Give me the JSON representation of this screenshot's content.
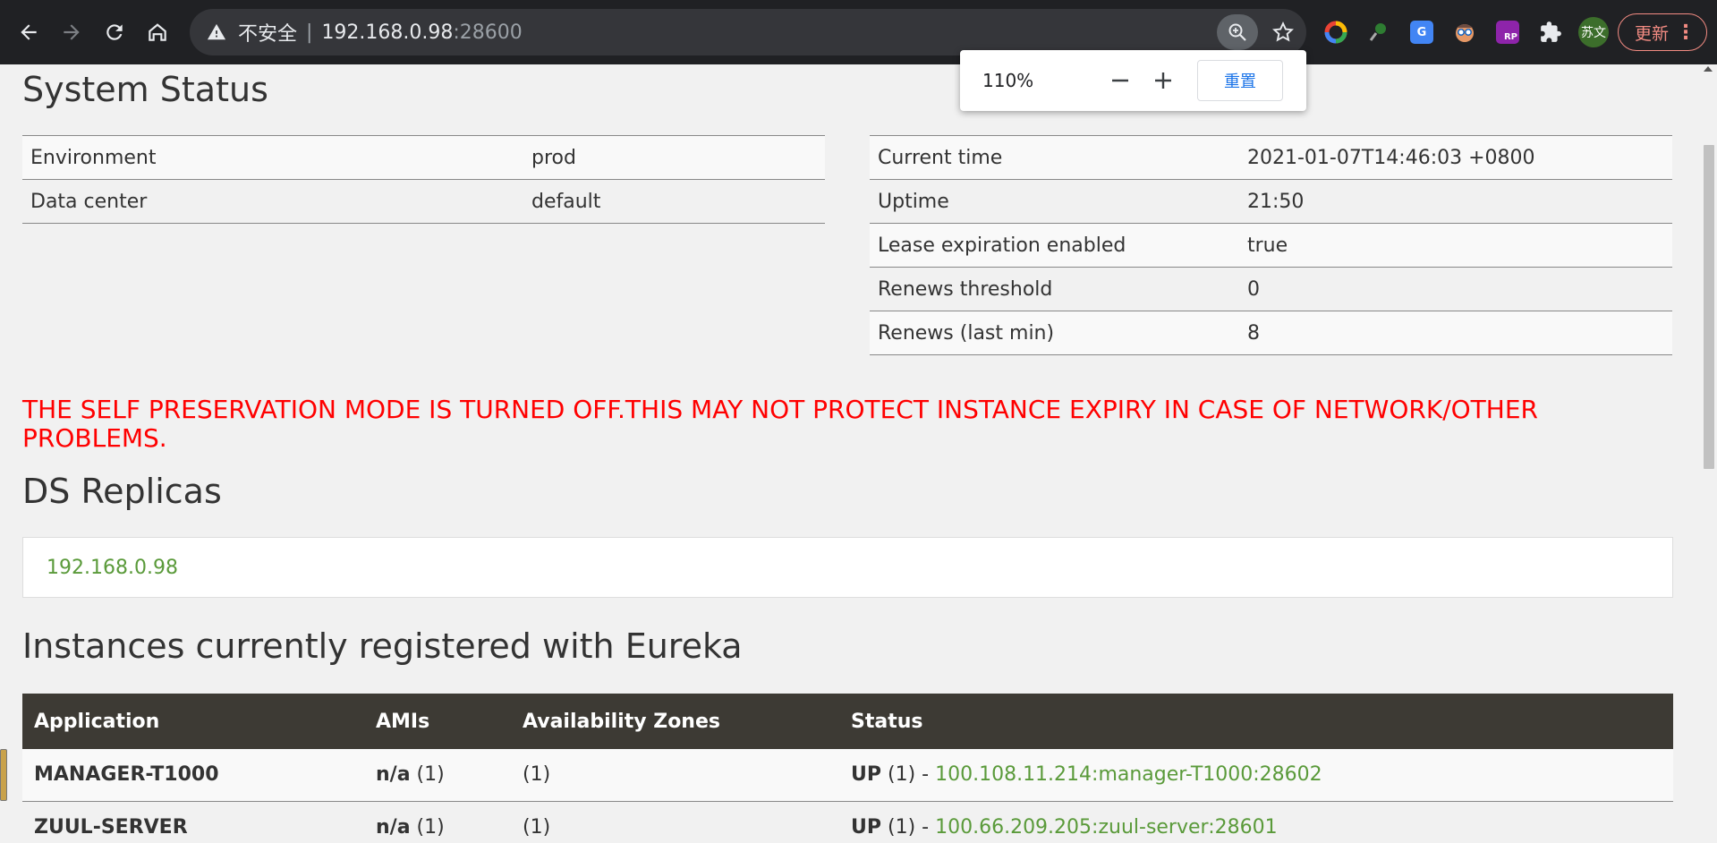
{
  "browser": {
    "security_label": "不安全",
    "separator": "|",
    "url_host": "192.168.0.98",
    "url_port": ":28600",
    "update_label": "更新",
    "profile_initials": "苏文"
  },
  "zoom_popup": {
    "level": "110%",
    "minus": "−",
    "plus": "+",
    "reset_label": "重置"
  },
  "system_status": {
    "title": "System Status",
    "left_rows": [
      {
        "label": "Environment",
        "value": "prod"
      },
      {
        "label": "Data center",
        "value": "default"
      }
    ],
    "right_rows": [
      {
        "label": "Current time",
        "value": "2021-01-07T14:46:03 +0800"
      },
      {
        "label": "Uptime",
        "value": "21:50"
      },
      {
        "label": "Lease expiration enabled",
        "value": "true"
      },
      {
        "label": "Renews threshold",
        "value": "0"
      },
      {
        "label": "Renews (last min)",
        "value": "8"
      }
    ]
  },
  "warning": "THE SELF PRESERVATION MODE IS TURNED OFF.THIS MAY NOT PROTECT INSTANCE EXPIRY IN CASE OF NETWORK/OTHER PROBLEMS.",
  "ds_replicas": {
    "title": "DS Replicas",
    "replica": "192.168.0.98"
  },
  "instances": {
    "title": "Instances currently registered with Eureka",
    "headers": [
      "Application",
      "AMIs",
      "Availability Zones",
      "Status"
    ],
    "rows": [
      {
        "app": "MANAGER-T1000",
        "ami": "n/a",
        "ami_count": " (1)",
        "zones": "(1)",
        "status": "UP",
        "status_count": " (1) - ",
        "instance": "100.108.11.214:manager-T1000:28602"
      },
      {
        "app": "ZUUL-SERVER",
        "ami": "n/a",
        "ami_count": " (1)",
        "zones": "(1)",
        "status": "UP",
        "status_count": " (1) - ",
        "instance": "100.66.209.205:zuul-server:28601"
      }
    ]
  },
  "colors": {
    "toolbar": "#202124",
    "warning": "#ff0000",
    "link_green": "#5a9a3a",
    "table_header": "#3d3a34"
  }
}
